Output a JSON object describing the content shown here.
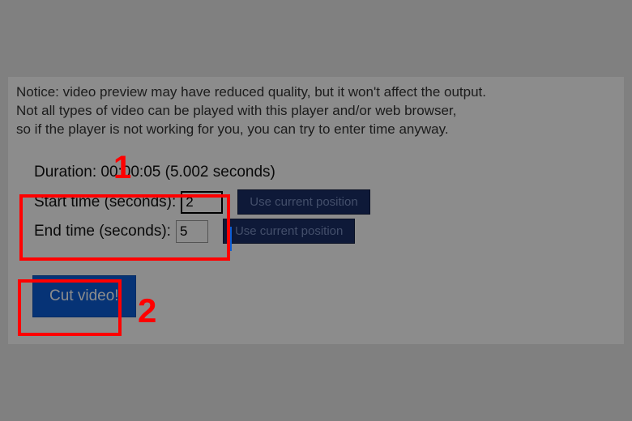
{
  "notice": {
    "line1": "Notice: video preview may have reduced quality, but it won't affect the output.",
    "line2": "Not all types of video can be played with this player and/or web browser,",
    "line3": "so if the player is not working for you, you can try to enter time anyway."
  },
  "duration_label": "Duration: 00:00:05 (5.002 seconds)",
  "form": {
    "start_label": "Start time (seconds):",
    "start_value": "2",
    "end_label": "End time (seconds):",
    "end_value": "5",
    "use_current_label": "Use current position"
  },
  "cut_button_label": "Cut video!",
  "callouts": {
    "one": "1",
    "two": "2"
  }
}
